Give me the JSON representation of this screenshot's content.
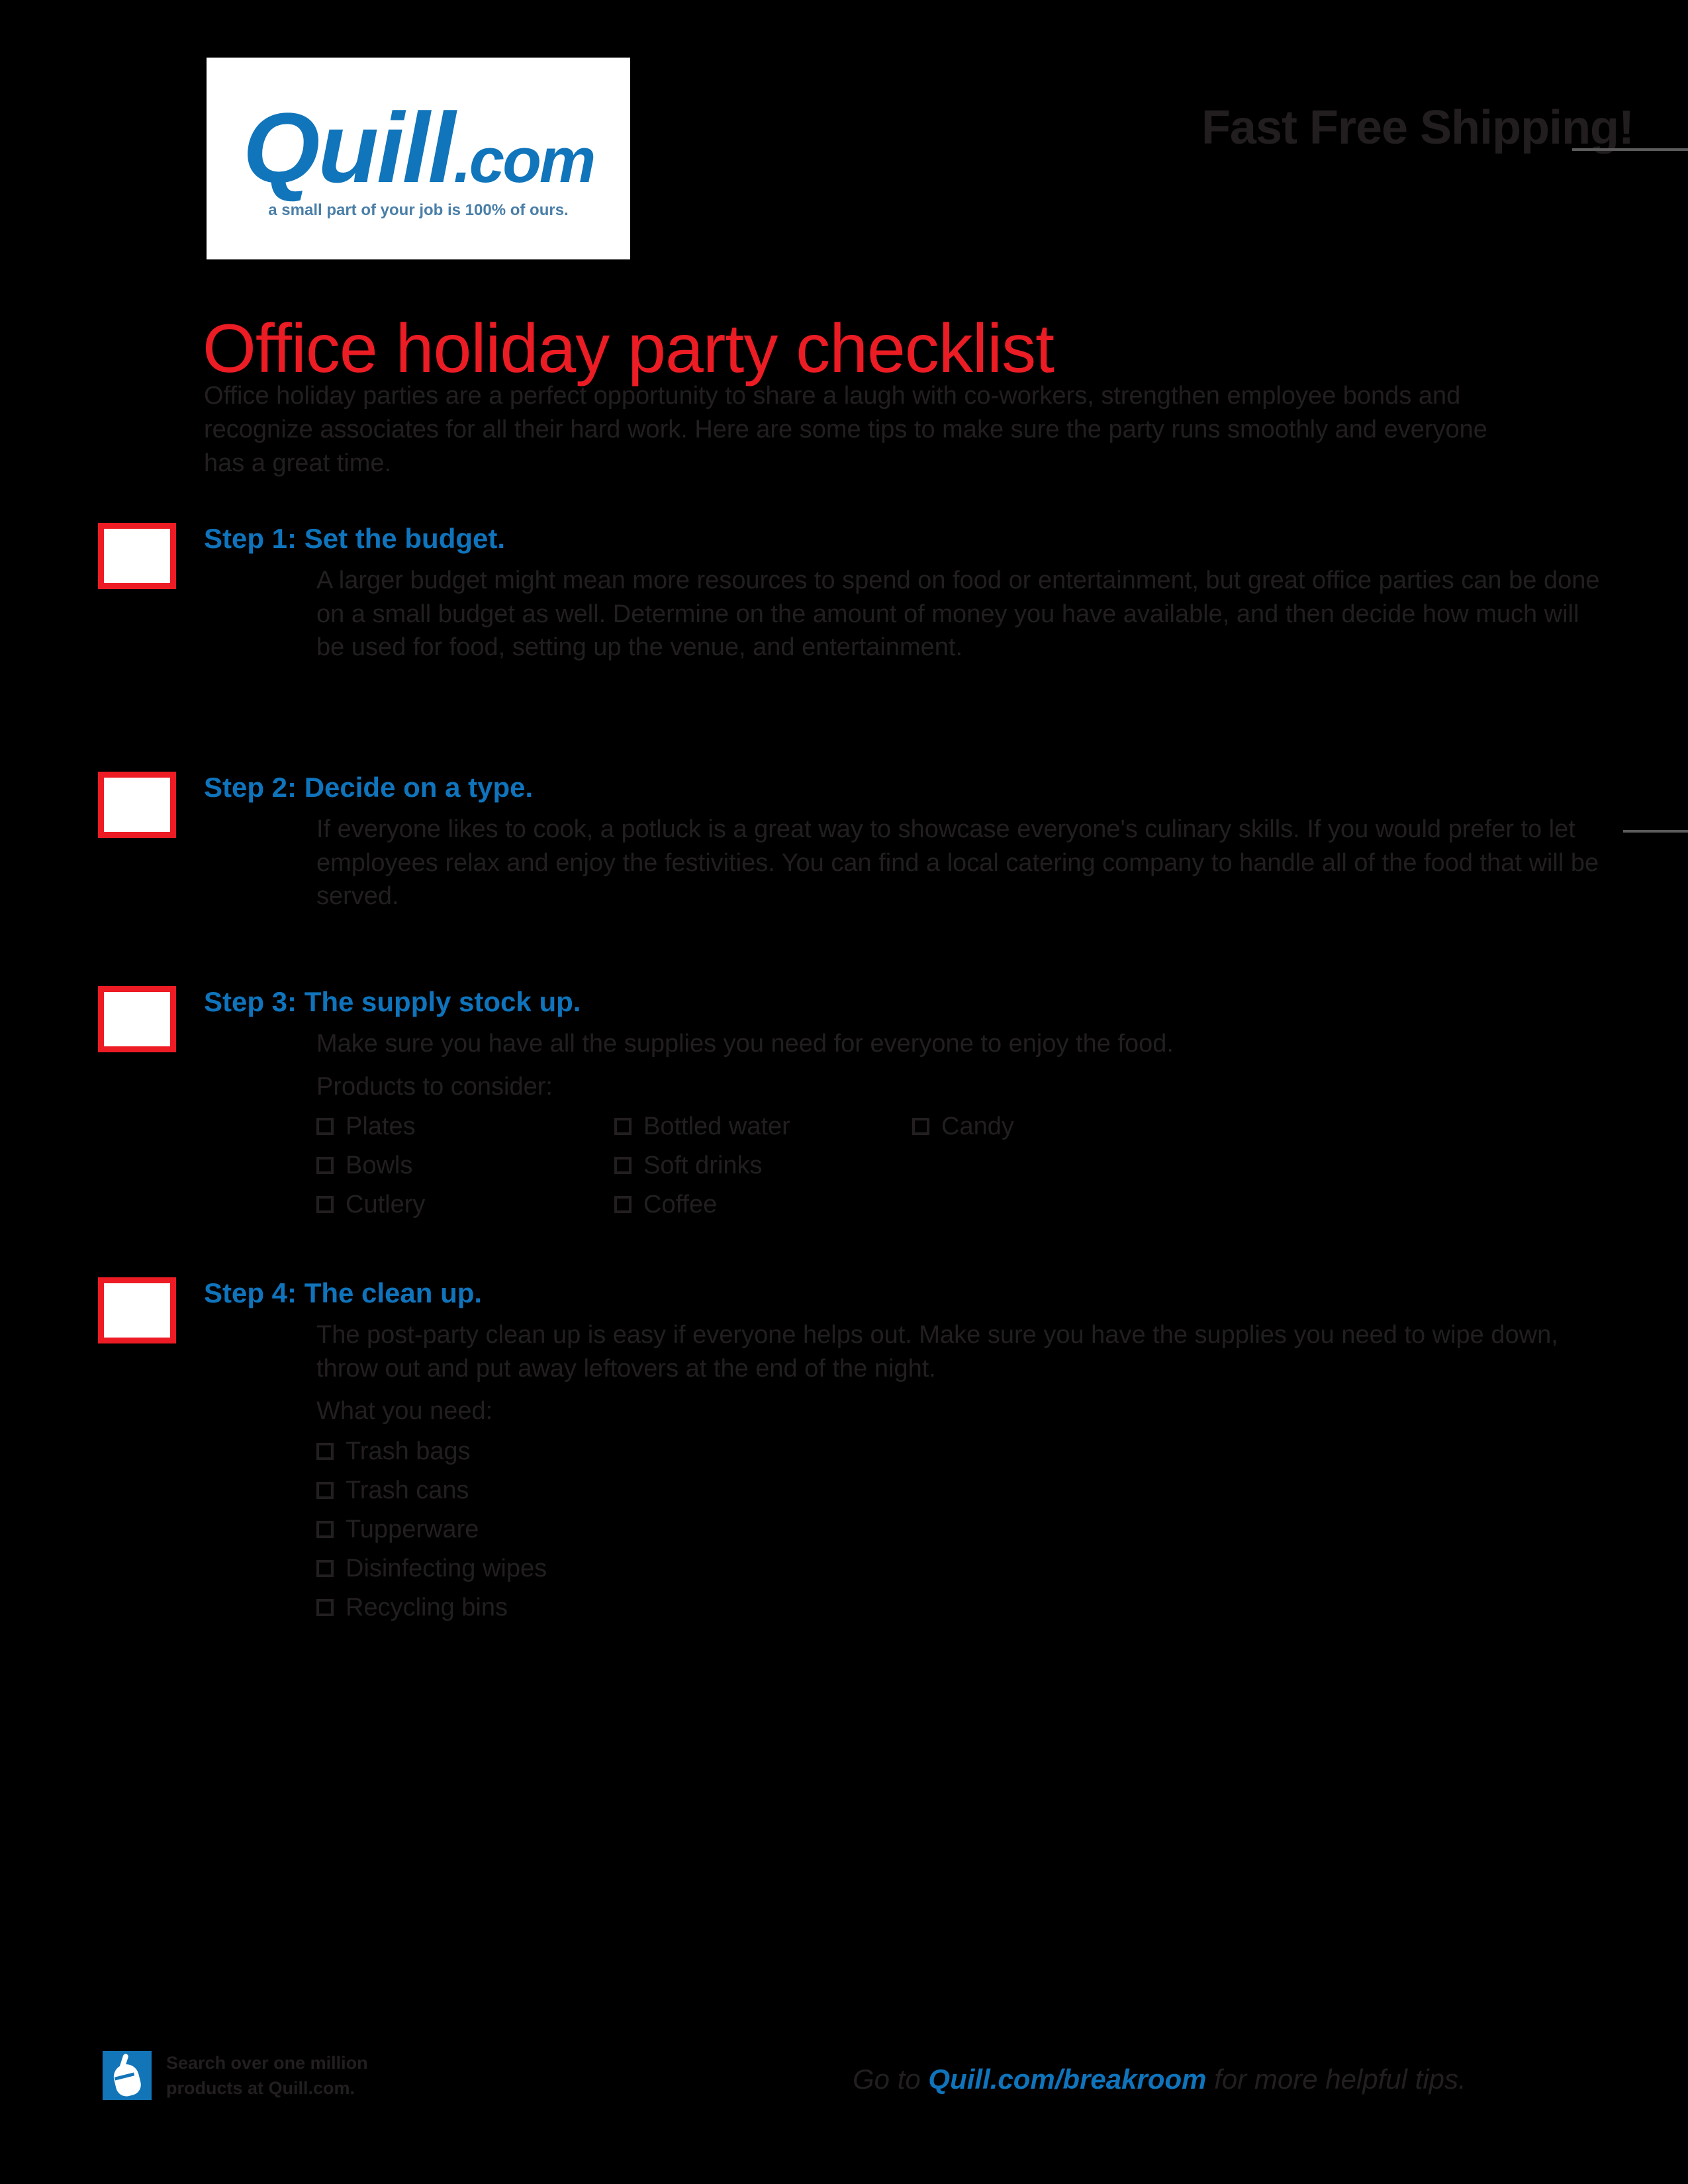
{
  "header": {
    "logo_word": "Quill",
    "logo_dotcom": ".com",
    "logo_tagline": "a small part of your job is 100% of ours.",
    "promo": "Fast Free Shipping!"
  },
  "title": "Office holiday party checklist",
  "intro": "Office holiday parties are a perfect opportunity to share a laugh with co-workers, strengthen employee bonds and recognize associates for all their hard work. Here are some tips to make sure the party runs smoothly and everyone has a great time.",
  "steps": [
    {
      "heading": "Step 1: Set the budget.",
      "text": "A larger budget might mean more resources to spend on food or entertainment, but great office parties can be done on a small budget as well. Determine on the amount of money you have available, and then decide how much will be used for food, setting up the venue, and entertainment."
    },
    {
      "heading": "Step 2: Decide on a type.",
      "text": "If everyone likes to cook, a potluck is a great way to showcase everyone's culinary skills. If you would prefer to let employees relax and enjoy the festivities. You can find a local catering company to handle all of the food that will be served."
    },
    {
      "heading": "Step 3: The supply stock up.",
      "text": "Make sure you have all the supplies you need for everyone to enjoy the food.",
      "sub_label": "Products to consider:",
      "columns": [
        [
          "Plates",
          "Bowls",
          "Cutlery"
        ],
        [
          "Bottled water",
          "Soft drinks",
          "Coffee"
        ],
        [
          "Candy"
        ]
      ]
    },
    {
      "heading": "Step 4: The clean up.",
      "text": "The post-party clean up is easy if everyone helps out. Make sure you have the supplies you need to wipe down, throw out and put away leftovers at the end of the night.",
      "sub_label": "What you need:",
      "items": [
        "Trash bags",
        "Trash cans",
        "Tupperware",
        "Disinfecting wipes",
        "Recycling bins"
      ]
    }
  ],
  "footer": {
    "left_line1": "Search over one million",
    "left_line2": "products at Quill.com.",
    "right_prefix": "Go to ",
    "right_link": "Quill.com/breakroom",
    "right_suffix": " for more helpful tips."
  },
  "colors": {
    "brand_blue": "#0F74BC",
    "accent_red": "#ED1C24",
    "title_red": "#EC1C24",
    "body_text": "#231F20",
    "page_bg": "#000000"
  }
}
